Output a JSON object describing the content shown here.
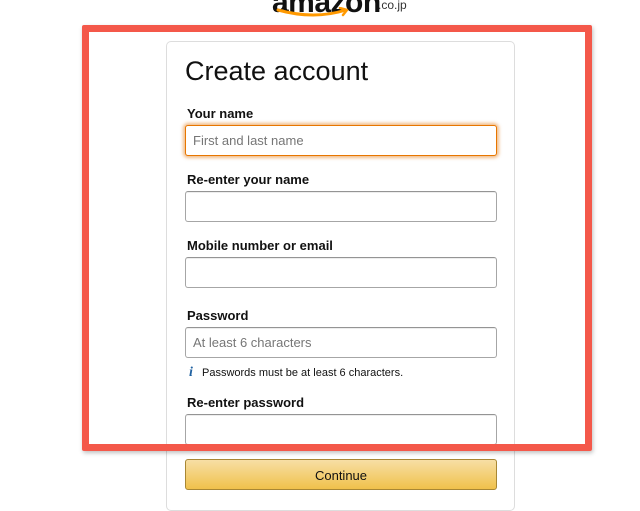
{
  "header": {
    "logo_word": "amazon",
    "logo_tld": ".co.jp"
  },
  "form": {
    "title": "Create account",
    "fields": [
      {
        "label": "Your name",
        "placeholder": "First and last name",
        "value": ""
      },
      {
        "label": "Re-enter your name",
        "placeholder": "",
        "value": ""
      },
      {
        "label": "Mobile number or email",
        "placeholder": "",
        "value": ""
      },
      {
        "label": "Password",
        "placeholder": "At least 6 characters",
        "value": ""
      },
      {
        "label": "Re-enter password",
        "placeholder": "",
        "value": ""
      }
    ],
    "password_hint": "Passwords must be at least 6 characters.",
    "hint_icon": "i",
    "continue_label": "Continue"
  },
  "colors": {
    "highlight": "#f4584a",
    "focus": "#e77600",
    "button": "#f0c14b",
    "info": "#2162a1"
  }
}
